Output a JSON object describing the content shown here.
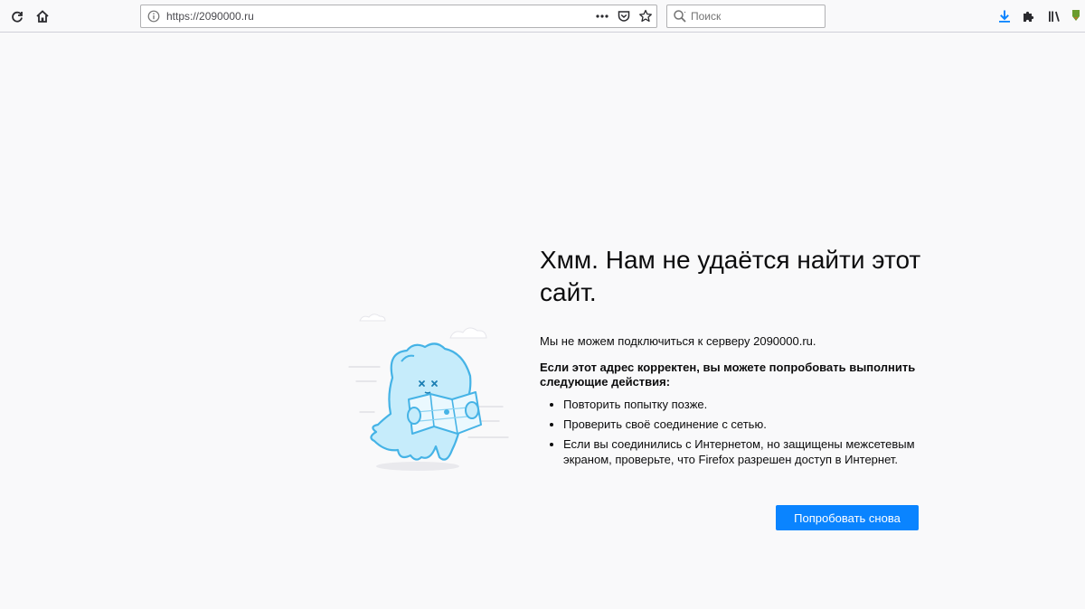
{
  "toolbar": {
    "reload_icon": "reload-icon",
    "home_icon": "home-icon",
    "url": "https://2090000.ru",
    "page_actions_icon": "more-dots-icon",
    "pocket_icon": "pocket-icon",
    "bookmark_icon": "star-icon",
    "search_placeholder": "Поиск",
    "downloads_icon": "download-arrow-icon",
    "addons_icon": "puzzle-icon",
    "library_icon": "library-icon",
    "extension_icon": "extension-icon",
    "accent_color": "#0a84ff"
  },
  "error": {
    "title": "Хмм. Нам не удаётся найти этот сайт.",
    "description": "Мы не можем подключиться к серверу 2090000.ru.",
    "suggestions_title": "Если этот адрес корректен, вы можете попробовать выполнить следующие действия:",
    "suggestions": [
      "Повторить попытку позже.",
      "Проверить своё соединение с сетью.",
      "Если вы соединились с Интернетом, но защищены межсетевым экраном, проверьте, что Firefox разрешен доступ в Интернет."
    ],
    "retry_label": "Попробовать снова",
    "illustration": "lost-monster-with-map-illustration"
  }
}
